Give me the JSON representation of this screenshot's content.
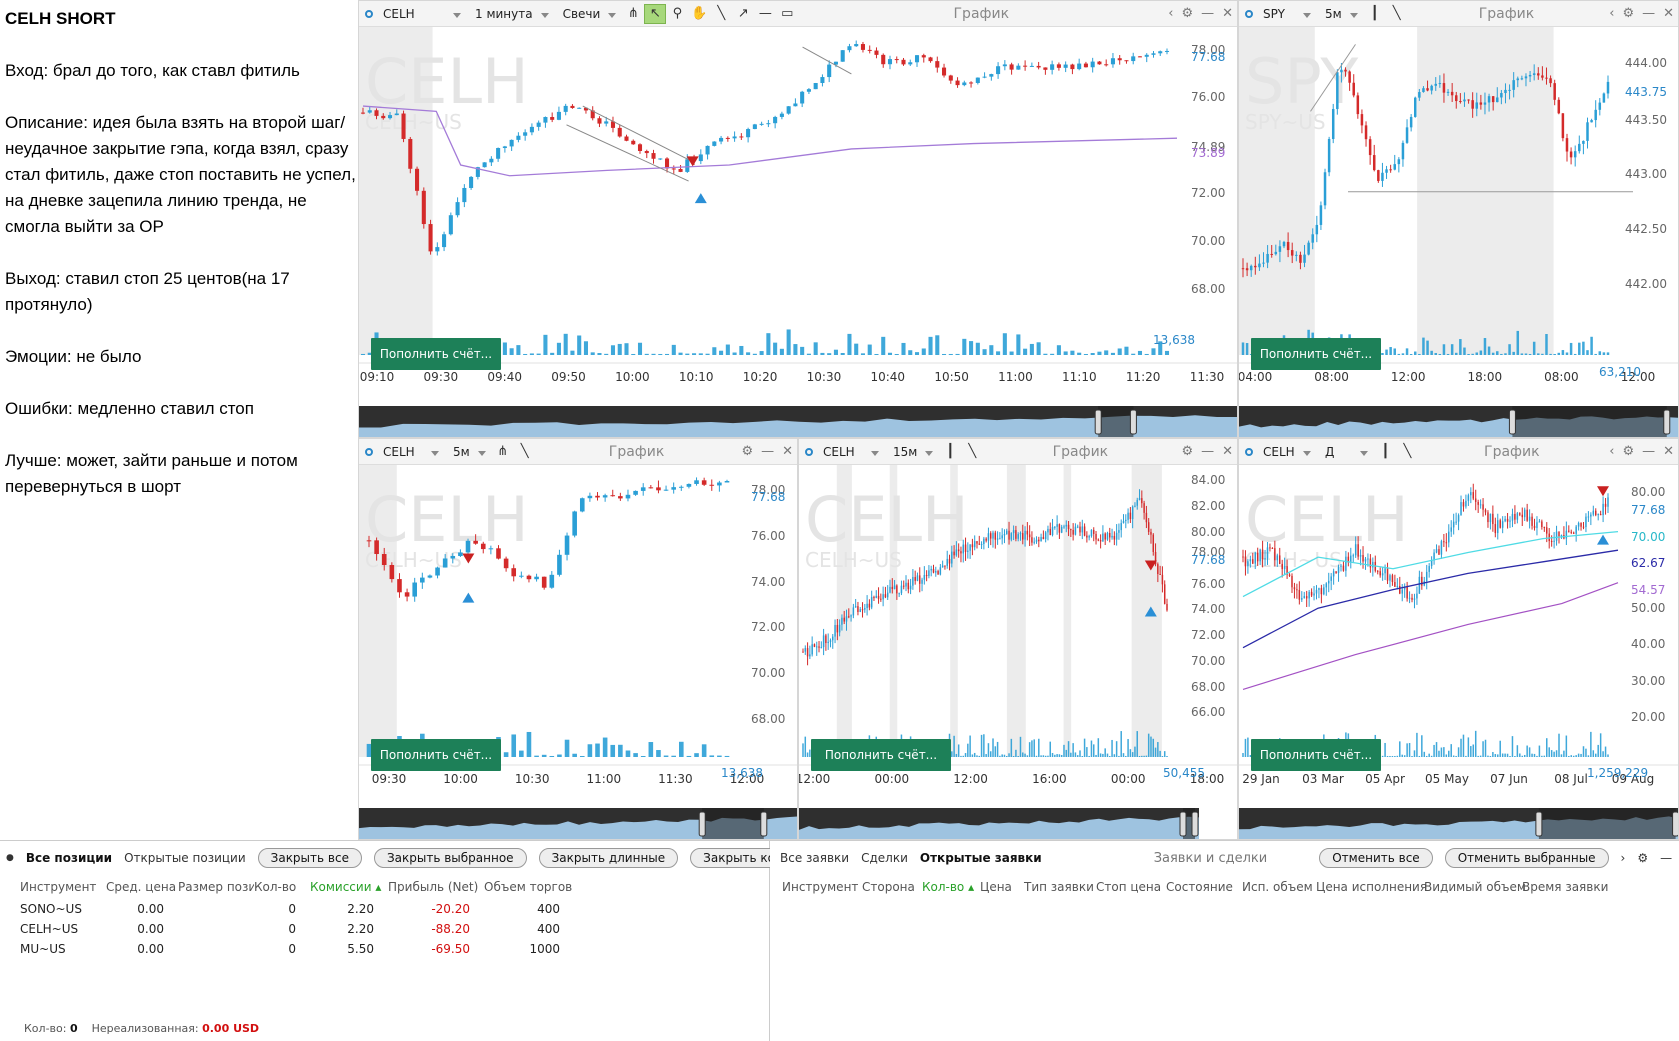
{
  "notes": {
    "title": "CELH SHORT",
    "paragraphs": [
      "Вход: брал до того, как ставл фитиль",
      "Описание: идея была взять на второй шаг/неудачное закрытие гэпа, когда взял, сразу стал фитиль, даже стоп поставить не успел, на дневке зацепила линию тренда, не смогла выйти за ОР",
      "Выход: ставил стоп 25 центов(на 17 протянуло)",
      "Эмоции: не было",
      "Ошибки: медленно ставил стоп",
      "Лучше: может, зайти раньше и потом перевернуться в шорт"
    ]
  },
  "common": {
    "graph_label": "График",
    "fund_button": "Пополнить счёт..."
  },
  "charts": {
    "c1": {
      "symbol": "CELH",
      "timeframe": "1 минута",
      "chart_type": "Свечи",
      "watermark": "CELH",
      "watermark_sub": "CELH~US",
      "y_ticks": [
        "78.00",
        "76.00",
        "74.00",
        "72.00",
        "70.00",
        "68.00"
      ],
      "price_label": "77.68",
      "vwap_label": "73.89",
      "bid_label": "74.89",
      "volume_label": "13,638",
      "x_ticks": [
        "09:10",
        "09:30",
        "09:40",
        "09:50",
        "10:00",
        "10:10",
        "10:20",
        "10:30",
        "10:40",
        "10:50",
        "11:00",
        "11:10",
        "11:20",
        "11:30"
      ]
    },
    "c2": {
      "symbol": "SPY",
      "timeframe": "5м",
      "watermark": "SPY",
      "watermark_sub": "SPY~US",
      "y_ticks": [
        "444.00",
        "443.50",
        "443.00",
        "442.50",
        "442.00"
      ],
      "price_label": "443.75",
      "volume_label": "63,210",
      "x_ticks": [
        "04:00",
        "08:00",
        "12:00",
        "18:00",
        "08:00",
        "12:00"
      ]
    },
    "c3": {
      "symbol": "CELH",
      "timeframe": "5м",
      "watermark": "CELH",
      "watermark_sub": "CELH~US",
      "y_ticks": [
        "78.00",
        "76.00",
        "74.00",
        "72.00",
        "70.00",
        "68.00"
      ],
      "price_label": "77.68",
      "volume_label": "13,638",
      "x_ticks": [
        "09:30",
        "10:00",
        "10:30",
        "11:00",
        "11:30",
        "12:00"
      ]
    },
    "c4": {
      "symbol": "CELH",
      "timeframe": "15м",
      "watermark": "CELH",
      "watermark_sub": "CELH~US",
      "y_ticks": [
        "84.00",
        "82.00",
        "80.00",
        "78.00",
        "76.00",
        "74.00",
        "72.00",
        "70.00",
        "68.00",
        "66.00"
      ],
      "price_label": "77.68",
      "volume_label": "50,455",
      "x_ticks": [
        "12:00",
        "00:00",
        "12:00",
        "16:00",
        "00:00",
        "18:00"
      ]
    },
    "c5": {
      "symbol": "CELH",
      "timeframe": "Д",
      "watermark": "CELH",
      "watermark_sub": "CELH~US",
      "y_ticks": [
        "80.00",
        "70.00",
        "60.00",
        "50.00",
        "40.00",
        "30.00",
        "20.00"
      ],
      "price_label": "77.68",
      "ma1_label": "70.00",
      "ma2_label": "62.67",
      "ma3_label": "54.57",
      "volume_label": "1,259,229",
      "x_ticks": [
        "29 Jan",
        "03 Mar",
        "05 Apr",
        "05 May",
        "07 Jun",
        "08 Jul",
        "09 Aug"
      ]
    }
  },
  "positions": {
    "tabs": [
      "Все позиции",
      "Открытые позиции"
    ],
    "buttons": [
      "Закрыть все",
      "Закрыть выбранное",
      "Закрыть длинные",
      "Закрыть короткие"
    ],
    "columns": [
      "Инструмент",
      "Сред. цена",
      "Размер пози",
      "Кол-во",
      "Комиссии",
      "Прибыль (Net)",
      "Объем торгов"
    ],
    "rows": [
      [
        "SONO~US",
        "0.00",
        "",
        "0",
        "2.20",
        "-20.20",
        "400"
      ],
      [
        "CELH~US",
        "0.00",
        "",
        "0",
        "2.20",
        "-88.20",
        "400"
      ],
      [
        "MU~US",
        "0.00",
        "",
        "0",
        "5.50",
        "-69.50",
        "1000"
      ]
    ],
    "footer_qty_label": "Кол-во:",
    "footer_qty": "0",
    "footer_unreal_label": "Нереализованная:",
    "footer_unreal": "0.00 USD"
  },
  "orders": {
    "tabs": [
      "Все заявки",
      "Сделки",
      "Открытые заявки"
    ],
    "title": "Заявки и сделки",
    "buttons": [
      "Отменить все",
      "Отменить выбранные"
    ],
    "columns": [
      "Инструмент",
      "Сторона",
      "Кол-во",
      "Цена",
      "Тип заявки",
      "Стоп цена",
      "Состояние",
      "Исп. объем",
      "Цена исполнения",
      "Видимый объем",
      "Время заявки"
    ]
  },
  "colors": {
    "up": "#2a9fd6",
    "down": "#d42a2a",
    "fund": "#1d8058",
    "accent": "#2a87c8"
  }
}
